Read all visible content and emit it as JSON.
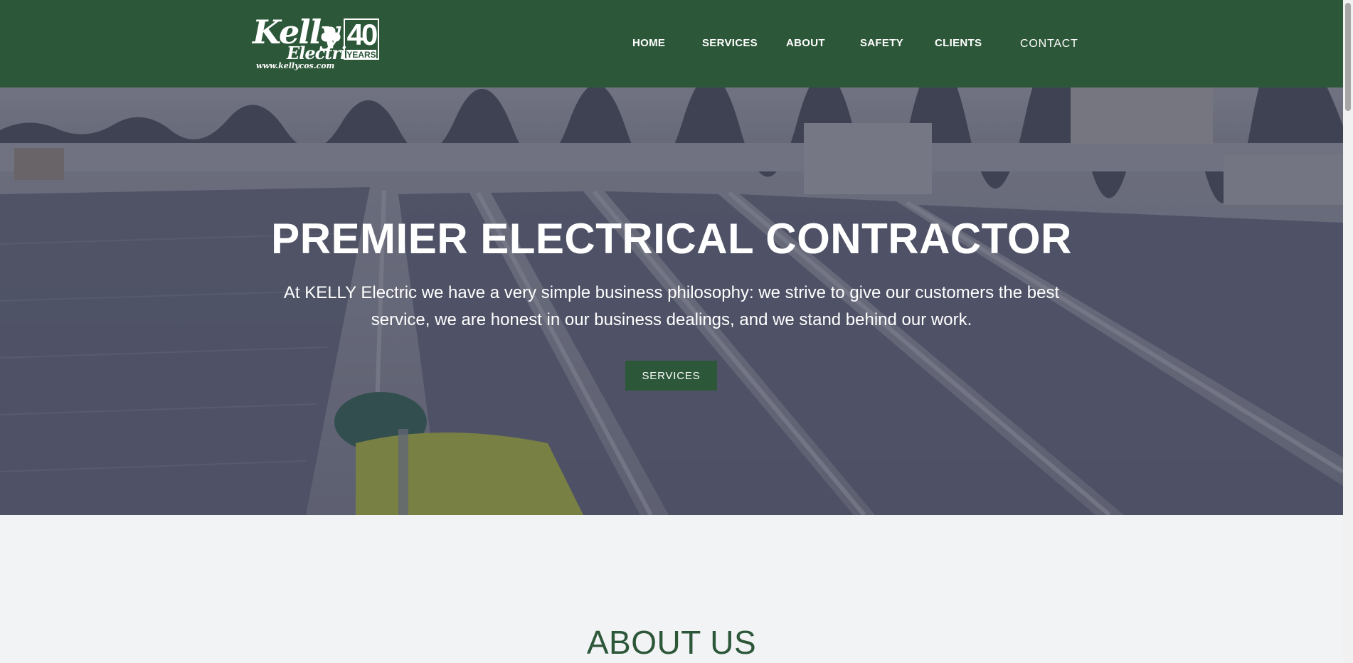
{
  "logo": {
    "line1": "Kelly",
    "line2": "Electric",
    "badge_number": "40",
    "badge_label": "YEARS",
    "url": "www.kellycos.com"
  },
  "nav": {
    "items": [
      {
        "label": "HOME"
      },
      {
        "label": "SERVICES"
      },
      {
        "label": "ABOUT"
      },
      {
        "label": "SAFETY"
      },
      {
        "label": "CLIENTS"
      },
      {
        "label": "CONTACT"
      }
    ]
  },
  "hero": {
    "title": "PREMIER ELECTRICAL CONTRACTOR",
    "text": "At KELLY Electric we have a very simple business philosophy: we strive to give our customers the best service, we are honest in our business dealings, and we stand behind our work.",
    "button_label": "SERVICES"
  },
  "about": {
    "title": "ABOUT US"
  },
  "colors": {
    "brand_green": "#2d5739",
    "page_background": "#f2f3f5",
    "hero_overlay": "#282a40"
  }
}
